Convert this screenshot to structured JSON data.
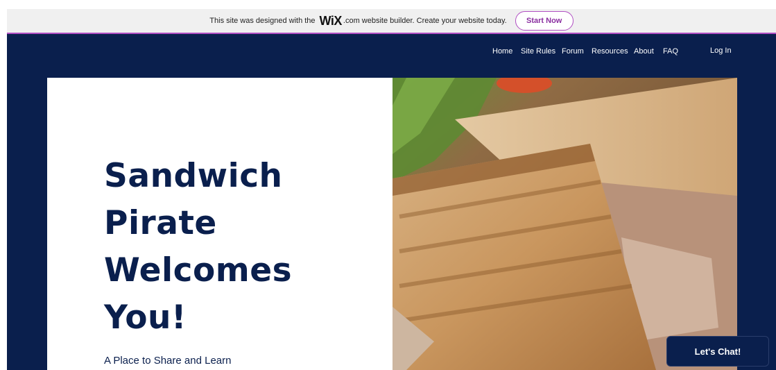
{
  "wix_banner": {
    "text_before": "This site was designed with the",
    "logo": "WiX",
    "logo_suffix": ".com website builder. Create your website today.",
    "cta": "Start Now"
  },
  "nav": {
    "items": [
      {
        "label": "Home"
      },
      {
        "label": "Site Rules"
      },
      {
        "label": "Forum"
      },
      {
        "label": "Resources"
      },
      {
        "label": "About"
      },
      {
        "label": "FAQ"
      }
    ],
    "login": "Log In"
  },
  "hero": {
    "title_lines": [
      "Sandwich",
      "Pirate",
      "Welcomes",
      "You!"
    ],
    "subtitle": "A Place to Share and Learn",
    "image_subject": "grilled-sandwich-photo"
  },
  "chat": {
    "label": "Let's Chat!"
  },
  "colors": {
    "navy": "#0a1f4d",
    "wix_accent": "#b04ec2",
    "banner_bg": "#f0f0f0"
  }
}
